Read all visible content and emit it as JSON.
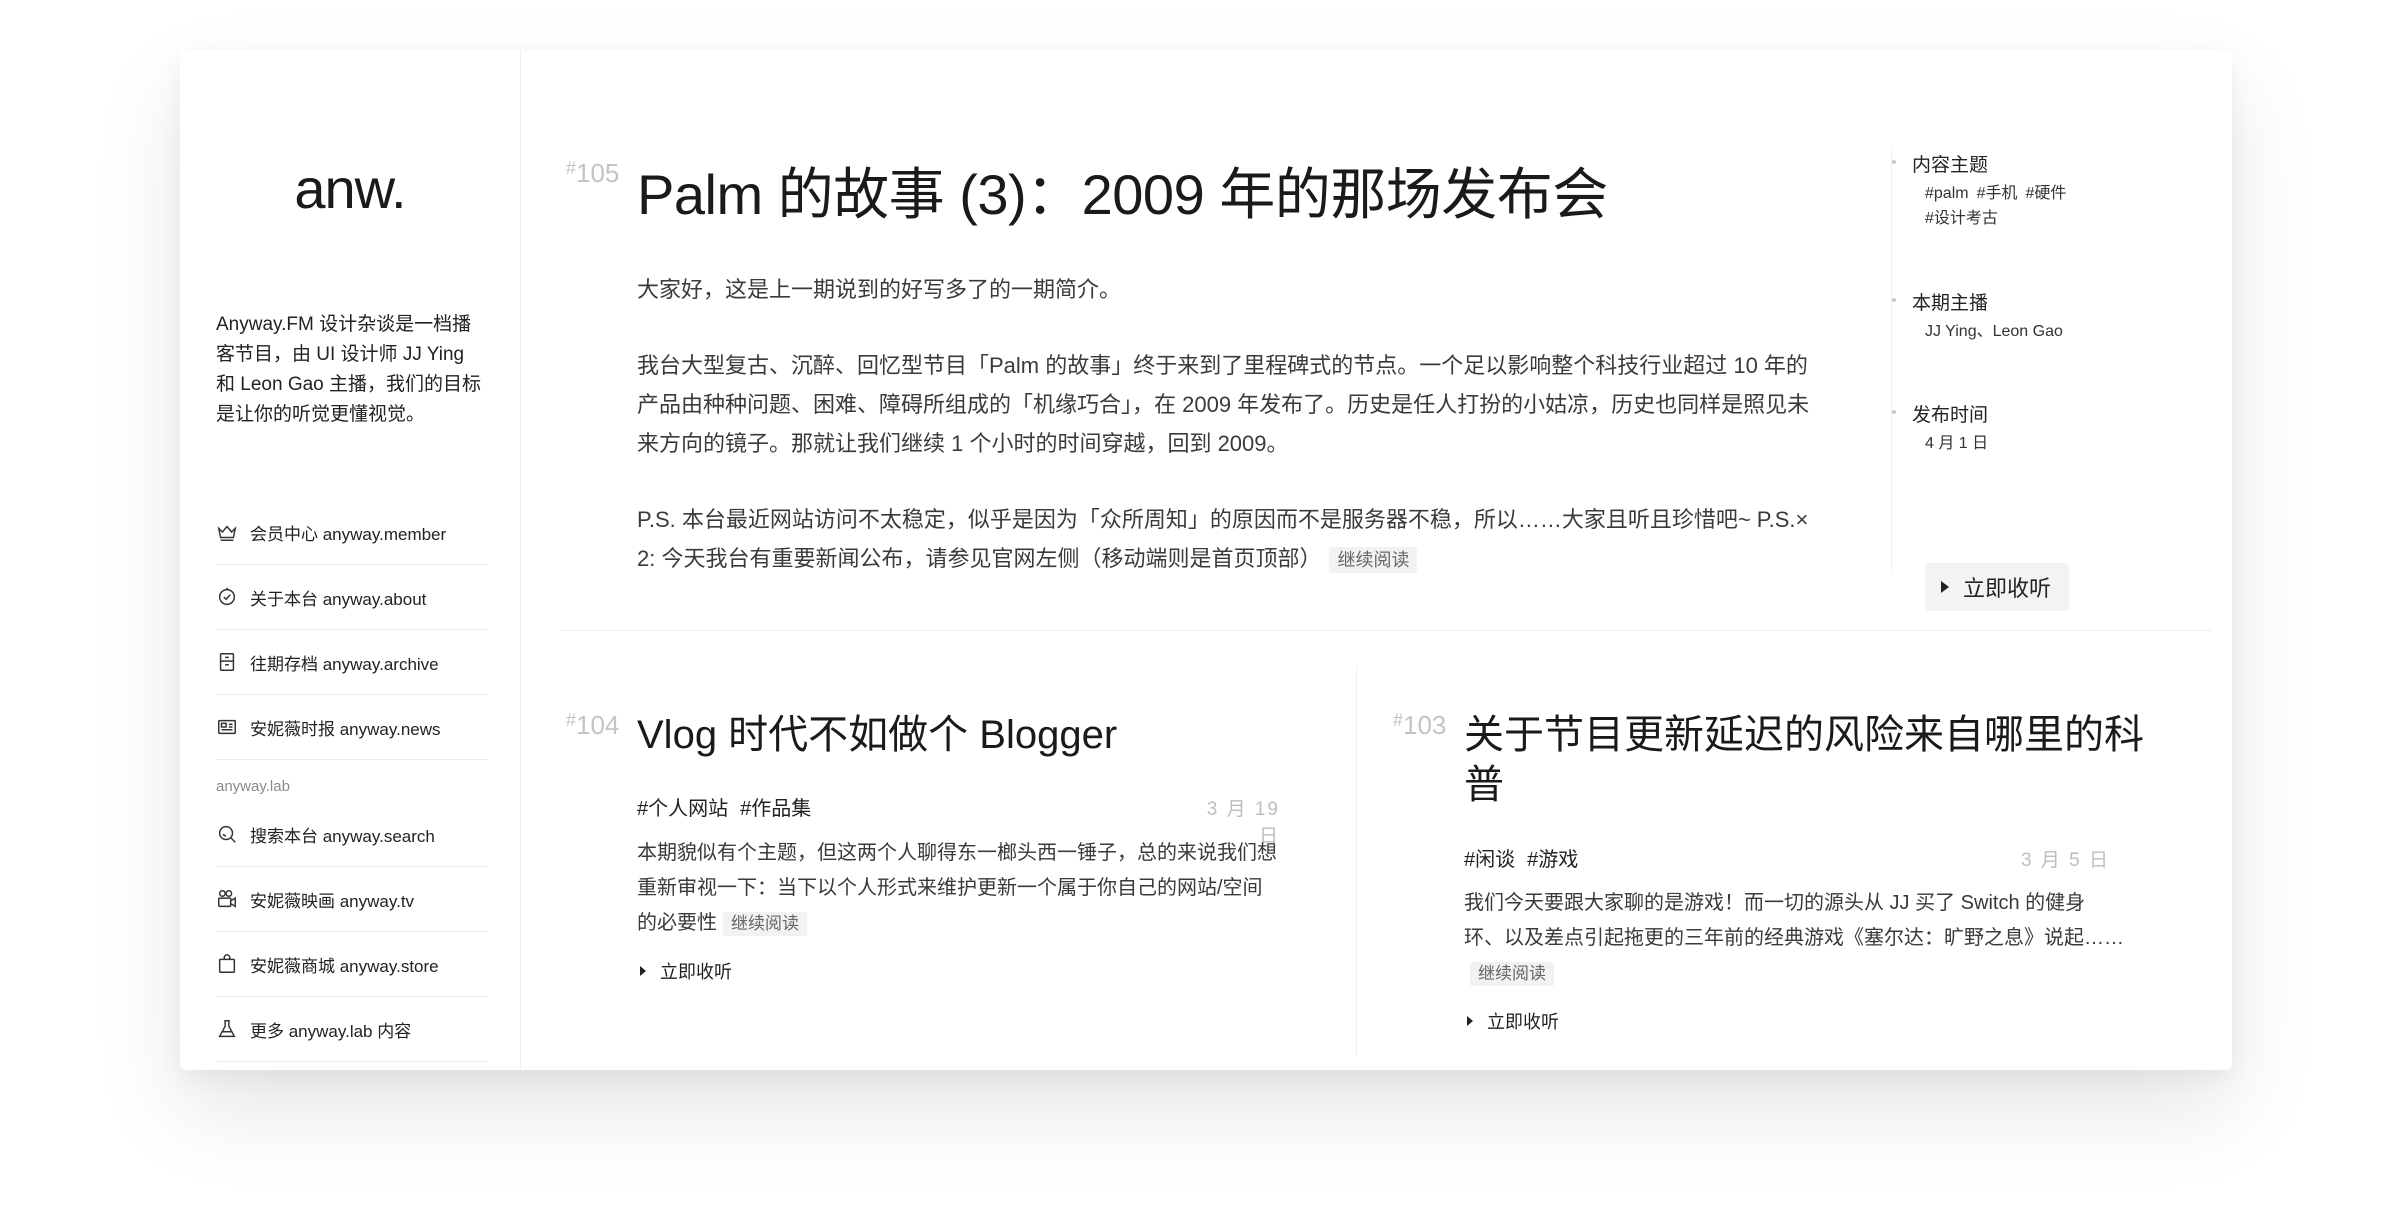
{
  "sidebar": {
    "logo": "anw.",
    "tagline": "Anyway.FM 设计杂谈是一档播客节目，由 UI 设计师 JJ Ying 和 Leon Gao 主播，我们的目标是让你的听觉更懂视觉。",
    "nav": [
      {
        "label": "会员中心 anyway.member",
        "icon": "crown-icon"
      },
      {
        "label": "关于本台 anyway.about",
        "icon": "badge-icon"
      },
      {
        "label": "往期存档 anyway.archive",
        "icon": "archive-icon"
      },
      {
        "label": "安妮薇时报 anyway.news",
        "icon": "newspaper-icon"
      }
    ],
    "lab_label": "anyway.lab",
    "lab_nav": [
      {
        "label": "搜索本台 anyway.search",
        "icon": "search-icon"
      },
      {
        "label": "安妮薇映画 anyway.tv",
        "icon": "camera-icon"
      },
      {
        "label": "安妮薇商城 anyway.store",
        "icon": "shopping-bag-icon"
      },
      {
        "label": "更多 anyway.lab 内容",
        "icon": "flask-icon"
      }
    ]
  },
  "featured": {
    "hash": "#",
    "number": "105",
    "title": "Palm 的故事 (3)：2009 年的那场发布会",
    "paragraphs": [
      "大家好，这是上一期说到的好写多了的一期简介。",
      "我台大型复古、沉醉、回忆型节目「Palm 的故事」终于来到了里程碑式的节点。一个足以影响整个科技行业超过 10 年的产品由种种问题、困难、障碍所组成的「机缘巧合」，在 2009 年发布了。历史是任人打扮的小姑凉，历史也同样是照见未来方向的镜子。那就让我们继续 1 个小时的时间穿越，回到 2009。",
      "P.S. 本台最近网站访问不太稳定，似乎是因为「众所周知」的原因而不是服务器不稳，所以……大家且听且珍惜吧~ P.S.× 2: 今天我台有重要新闻公布，请参见官网左侧（移动端则是首页顶部）"
    ],
    "read_more": "继续阅读",
    "meta": {
      "topics_label": "内容主题",
      "topics": [
        "#palm",
        "#手机",
        "#硬件",
        "#设计考古"
      ],
      "hosts_label": "本期主播",
      "hosts": "JJ Ying、Leon Gao",
      "date_label": "发布时间",
      "date": "4 月 1 日"
    },
    "subscribe": "立即收听"
  },
  "episodes": [
    {
      "hash": "#",
      "number": "104",
      "title": "Vlog 时代不如做个 Blogger",
      "tags": [
        "#个人网站",
        "#作品集"
      ],
      "date": "3 月 19 日",
      "body": "本期貌似有个主题，但这两个人聊得东一榔头西一锤子，总的来说我们想重新审视一下：当下以个人形式来维护更新一个属于你自己的网站/空间的必要性",
      "read_more": "继续阅读",
      "subscribe": "立即收听"
    },
    {
      "hash": "#",
      "number": "103",
      "title": "关于节目更新延迟的风险来自哪里的科普",
      "tags": [
        "#闲谈",
        "#游戏"
      ],
      "date": "3 月 5 日",
      "body": "我们今天要跟大家聊的是游戏！而一切的源头从 JJ 买了 Switch 的健身环、以及差点引起拖更的三年前的经典游戏《塞尔达：旷野之息》说起……",
      "read_more": "继续阅读",
      "subscribe": "立即收听"
    }
  ]
}
